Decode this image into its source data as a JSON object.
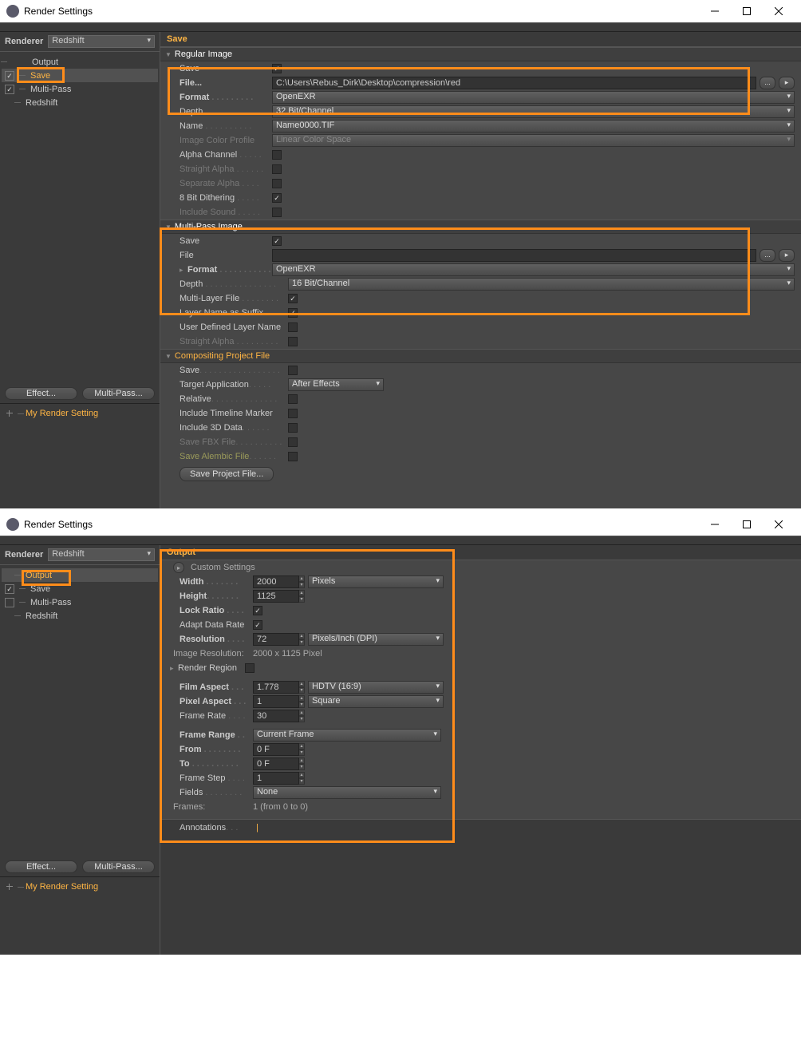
{
  "window_title": "Render Settings",
  "renderer_label": "Renderer",
  "renderer_value": "Redshift",
  "sidebar_w1": {
    "output": "Output",
    "save": "Save",
    "multipass": "Multi-Pass",
    "redshift": "Redshift"
  },
  "sidebar_w2": {
    "output": "Output",
    "save": "Save",
    "multipass": "Multi-Pass",
    "redshift": "Redshift"
  },
  "effect_btn": "Effect...",
  "multipass_btn": "Multi-Pass...",
  "preset": "My Render Setting",
  "bottom_preset": "Render Setting...",
  "save_panel": {
    "title": "Save",
    "regular": {
      "header": "Regular Image",
      "save_l": "Save",
      "save_v": true,
      "file_l": "File...",
      "file_v": "C:\\Users\\Rebus_Dirk\\Desktop\\compression\\red",
      "format_l": "Format",
      "format_v": "OpenEXR",
      "depth_l": "Depth",
      "depth_v": "32 Bit/Channel",
      "name_l": "Name",
      "name_v": "Name0000.TIF",
      "icp_l": "Image Color Profile",
      "icp_v": "Linear Color Space",
      "alpha_l": "Alpha Channel",
      "alpha_v": false,
      "salpha_l": "Straight Alpha",
      "salpha_v": false,
      "sepalpha_l": "Separate Alpha",
      "sepalpha_v": false,
      "dither_l": "8 Bit Dithering",
      "dither_v": true,
      "sound_l": "Include Sound",
      "sound_v": false
    },
    "multipass": {
      "header": "Multi-Pass Image",
      "save_l": "Save",
      "save_v": true,
      "file_l": "File",
      "file_v": "",
      "format_l": "Format",
      "format_v": "OpenEXR",
      "depth_l": "Depth",
      "depth_v": "16 Bit/Channel",
      "mlf_l": "Multi-Layer File",
      "mlf_v": true,
      "suffix_l": "Layer Name as Suffix",
      "suffix_v": true,
      "udln_l": "User Defined Layer Name",
      "udln_v": false,
      "salpha_l": "Straight Alpha",
      "salpha_v": false
    },
    "comp": {
      "header": "Compositing Project File",
      "save_l": "Save",
      "save_v": false,
      "target_l": "Target Application",
      "target_v": "After Effects",
      "rel_l": "Relative",
      "rel_v": false,
      "tm_l": "Include Timeline Marker",
      "tm_v": false,
      "d3_l": "Include 3D Data",
      "d3_v": false,
      "fbx_l": "Save FBX File",
      "fbx_v": false,
      "abc_l": "Save Alembic File",
      "abc_v": false,
      "btn": "Save Project File..."
    }
  },
  "output_panel": {
    "title": "Output",
    "custom": "Custom Settings",
    "width_l": "Width",
    "width_v": "2000",
    "width_unit": "Pixels",
    "height_l": "Height",
    "height_v": "1125",
    "lock_l": "Lock Ratio",
    "lock_v": true,
    "adapt_l": "Adapt Data Rate",
    "adapt_v": true,
    "res_l": "Resolution",
    "res_v": "72",
    "res_unit": "Pixels/Inch (DPI)",
    "imgres_l": "Image Resolution:",
    "imgres_v": "2000 x 1125 Pixel",
    "region_l": "Render Region",
    "region_v": false,
    "fa_l": "Film Aspect",
    "fa_v": "1.778",
    "fa_preset": "HDTV (16:9)",
    "pa_l": "Pixel Aspect",
    "pa_v": "1",
    "pa_preset": "Square",
    "fr_l": "Frame Rate",
    "fr_v": "30",
    "frange_l": "Frame Range",
    "frange_v": "Current Frame",
    "from_l": "From",
    "from_v": "0 F",
    "to_l": "To",
    "to_v": "0 F",
    "step_l": "Frame Step",
    "step_v": "1",
    "fields_l": "Fields",
    "fields_v": "None",
    "frames_l": "Frames:",
    "frames_v": "1 (from 0 to 0)",
    "ann_l": "Annotations"
  }
}
